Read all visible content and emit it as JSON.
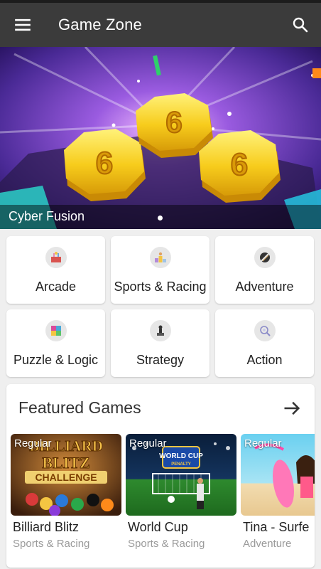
{
  "app_bar": {
    "title": "Game Zone",
    "menu_icon": "hamburger-menu-icon",
    "search_icon": "search-icon"
  },
  "banner": {
    "title": "Cyber Fusion",
    "active_slide": 1
  },
  "categories": [
    {
      "label": "Arcade",
      "icon": "arcade-icon"
    },
    {
      "label": "Sports & Racing",
      "icon": "sports-racing-icon"
    },
    {
      "label": "Adventure",
      "icon": "adventure-icon"
    },
    {
      "label": "Puzzle & Logic",
      "icon": "puzzle-icon"
    },
    {
      "label": "Strategy",
      "icon": "strategy-icon"
    },
    {
      "label": "Action",
      "icon": "action-icon"
    }
  ],
  "featured": {
    "title": "Featured Games",
    "arrow_icon": "arrow-right-icon",
    "games": [
      {
        "badge": "Regular",
        "name": "Billiard Blitz",
        "genre": "Sports & Racing",
        "thumb_text": [
          "BILLIARD",
          "BLITZ",
          "CHALLENGE"
        ]
      },
      {
        "badge": "Regular",
        "name": "World Cup",
        "genre": "Sports & Racing",
        "thumb_text": [
          "WORLD CUP",
          "PENALTY"
        ]
      },
      {
        "badge": "Regular",
        "name": "Tina - Surfe",
        "genre": "Adventure",
        "thumb_text": []
      }
    ]
  },
  "colors": {
    "app_bar": "#3b3b3b",
    "background": "#efefef",
    "card": "#ffffff",
    "secondary_text": "#9a9a9a"
  }
}
